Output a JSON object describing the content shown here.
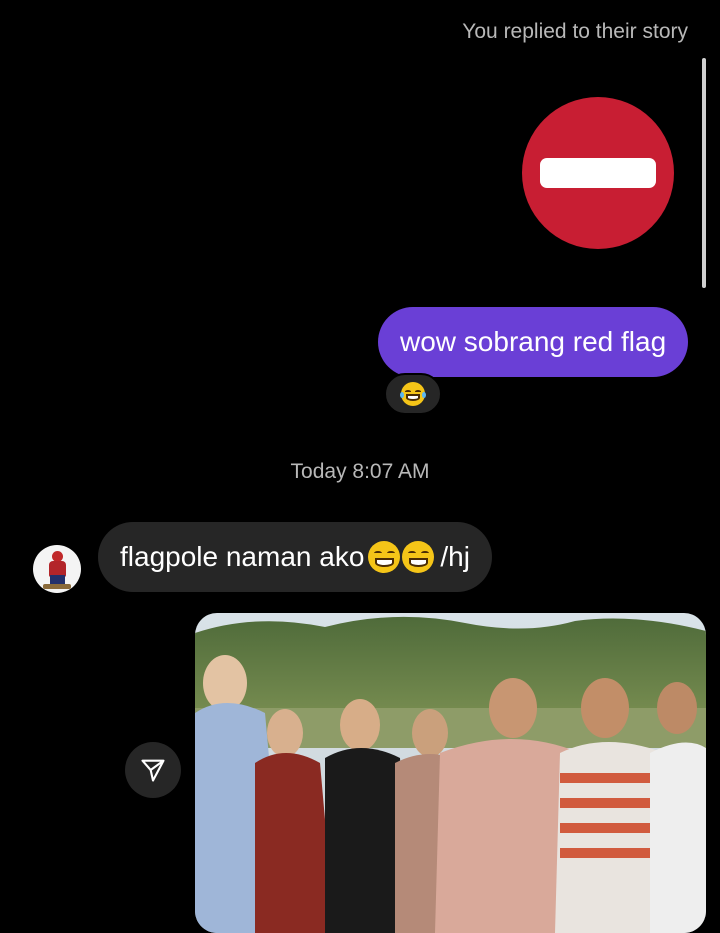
{
  "conversation": {
    "story_reply_caption": "You replied to their story",
    "story_preview_icon": "no-entry-sign",
    "sent_message": "wow sobrang red flag",
    "sent_reaction": "grinning-squinting-face-with-tears",
    "timestamp": "Today 8:07 AM",
    "received_message": {
      "text": "flagpole naman ako",
      "emojis": [
        "beaming-face",
        "beaming-face"
      ],
      "suffix": "/hj"
    },
    "shared_photo_icon": "share-icon"
  },
  "colors": {
    "background": "#000000",
    "sent_bubble": "#6a3fd6",
    "received_bubble": "#262626",
    "muted_text": "#b8b8b8",
    "no_entry_red": "#c81e33"
  }
}
